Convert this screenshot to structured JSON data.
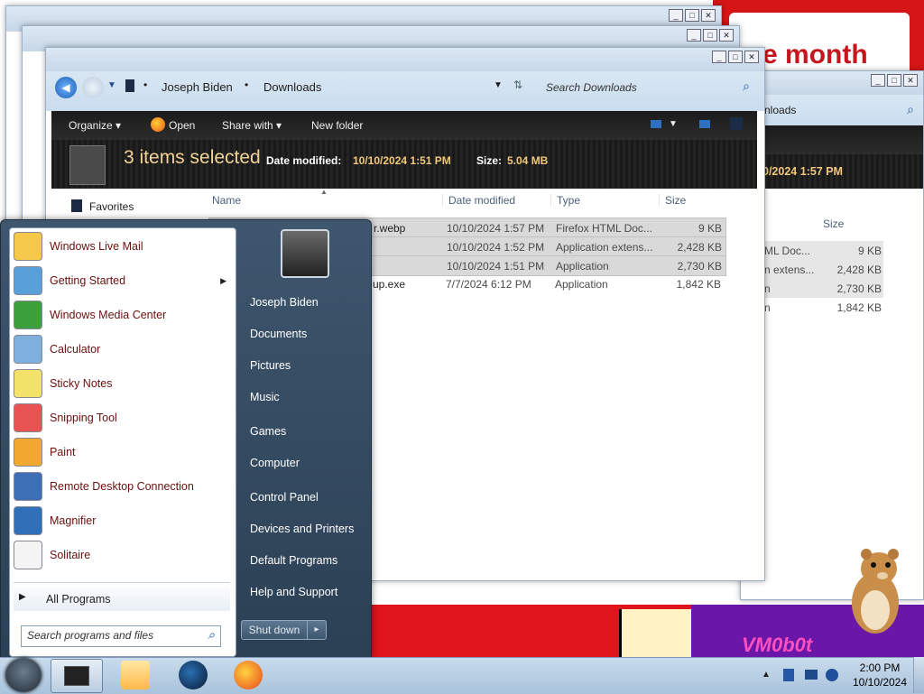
{
  "desktop": {
    "banner_text": "e month",
    "corner_text": "VM0b0t"
  },
  "back_window": {
    "address_tail": "nloads",
    "details": {
      "date_modified_tail": "0/2024 1:57 PM"
    },
    "columns": {
      "size": "Size"
    },
    "rows": [
      {
        "type": "ML Doc...",
        "size": "9 KB"
      },
      {
        "type": "n extens...",
        "size": "2,428 KB"
      },
      {
        "type": "n",
        "size": "2,730 KB"
      },
      {
        "type": "n",
        "size": "1,842 KB"
      }
    ]
  },
  "explorer": {
    "breadcrumb": {
      "user": "Joseph Biden",
      "folder": "Downloads"
    },
    "search_placeholder": "Search Downloads",
    "toolbar": {
      "organize": "Organize",
      "open": "Open",
      "share_with": "Share with",
      "new_folder": "New folder"
    },
    "details": {
      "selection": "3 items selected",
      "date_label": "Date modified:",
      "date_value": "10/10/2024 1:51 PM",
      "size_label": "Size:",
      "size_value": "5.04 MB"
    },
    "nav": {
      "favorites": "Favorites"
    },
    "columns": {
      "name": "Name",
      "date": "Date modified",
      "type": "Type",
      "size": "Size"
    },
    "rows": [
      {
        "name": "r.webp",
        "date": "10/10/2024 1:57 PM",
        "type": "Firefox HTML Doc...",
        "size": "9 KB",
        "selected": true
      },
      {
        "name": "",
        "date": "10/10/2024 1:52 PM",
        "type": "Application extens...",
        "size": "2,428 KB",
        "selected": true
      },
      {
        "name": "",
        "date": "10/10/2024 1:51 PM",
        "type": "Application",
        "size": "2,730 KB",
        "selected": true
      },
      {
        "name": "up.exe",
        "date": "7/7/2024 6:12 PM",
        "type": "Application",
        "size": "1,842 KB",
        "selected": false
      }
    ]
  },
  "start_menu": {
    "programs": [
      {
        "label": "Windows Live Mail",
        "icon": "mail-icon"
      },
      {
        "label": "Getting Started",
        "icon": "getting-started-icon"
      },
      {
        "label": "Windows Media Center",
        "icon": "media-center-icon"
      },
      {
        "label": "Calculator",
        "icon": "calculator-icon"
      },
      {
        "label": "Sticky Notes",
        "icon": "sticky-notes-icon"
      },
      {
        "label": "Snipping Tool",
        "icon": "scissors-icon"
      },
      {
        "label": "Paint",
        "icon": "paint-icon"
      },
      {
        "label": "Remote Desktop Connection",
        "icon": "remote-desktop-icon"
      },
      {
        "label": "Magnifier",
        "icon": "magnifier-icon"
      },
      {
        "label": "Solitaire",
        "icon": "cards-icon"
      }
    ],
    "all_programs": "All Programs",
    "search_placeholder": "Search programs and files",
    "right_items": [
      "Joseph Biden",
      "Documents",
      "Pictures",
      "Music",
      "Games",
      "Computer",
      "Control Panel",
      "Devices and Printers",
      "Default Programs",
      "Help and Support"
    ],
    "shutdown": "Shut down"
  },
  "taskbar": {
    "time": "2:00 PM",
    "date": "10/10/2024"
  }
}
